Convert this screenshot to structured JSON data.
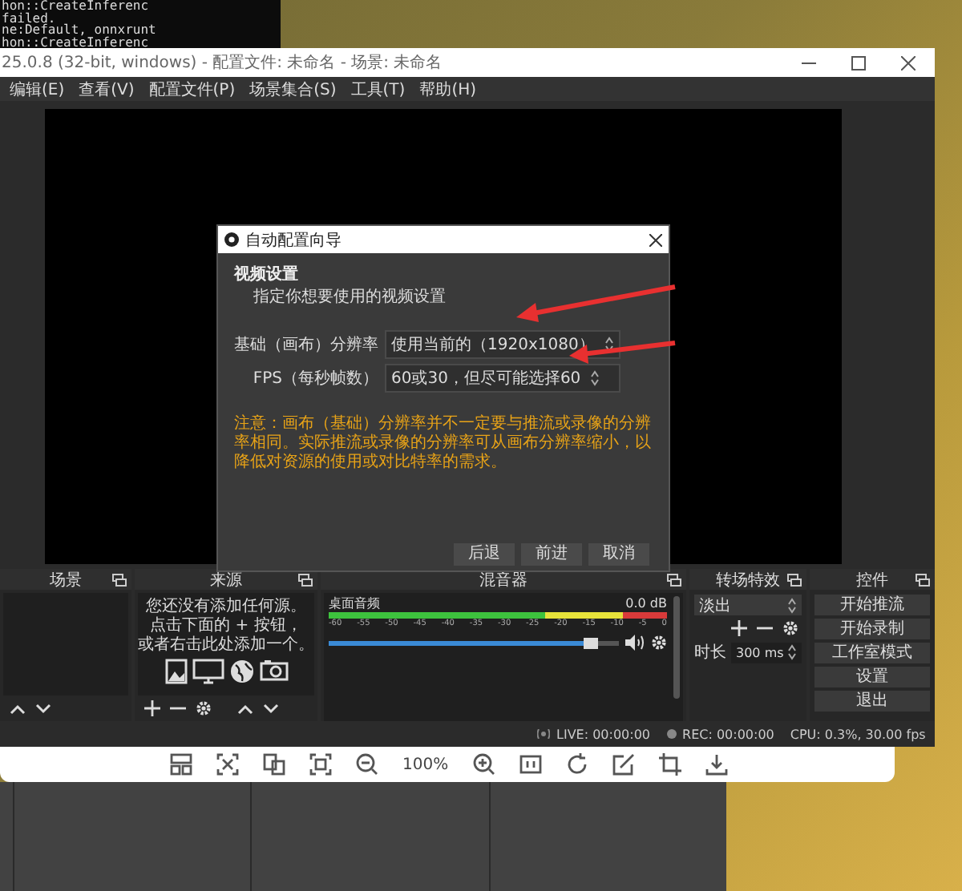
{
  "console": {
    "lines": [
      "hon::CreateInferenc",
      "failed.",
      "ne:Default, onnxrunt",
      "hon::CreateInferenc"
    ]
  },
  "window": {
    "title": "25.0.8 (32-bit, windows) - 配置文件: 未命名 - 场景: 未命名"
  },
  "menu": [
    "编辑(E)",
    "查看(V)",
    "配置文件(P)",
    "场景集合(S)",
    "工具(T)",
    "帮助(H)"
  ],
  "dialog": {
    "title": "自动配置向导",
    "heading": "视频设置",
    "subheading": "指定你想要使用的视频设置",
    "fields": [
      {
        "label": "基础（画布）分辨率",
        "value": "使用当前的（1920x1080）"
      },
      {
        "label": "FPS（每秒帧数）",
        "value": "60或30，但尽可能选择60"
      }
    ],
    "note": "注意：画布（基础）分辨率并不一定要与推流或录像的分辨率相同。实际推流或录像的分辨率可从画布分辨率缩小，以降低对资源的使用或对比特率的需求。",
    "buttons": [
      "后退",
      "前进",
      "取消"
    ]
  },
  "docks": {
    "scenes": {
      "title": "场景"
    },
    "sources": {
      "title": "来源",
      "empty_message": [
        "您还没有添加任何源。",
        "点击下面的 + 按钮，",
        "或者右击此处添加一个。"
      ]
    },
    "mixer": {
      "title": "混音器",
      "channels": [
        {
          "name": "桌面音频",
          "reading": "0.0 dB",
          "ticks": [
            "-60",
            "-55",
            "-50",
            "-45",
            "-40",
            "-35",
            "-30",
            "-25",
            "-20",
            "-15",
            "-10",
            "-5",
            "0"
          ],
          "level": 0.93
        }
      ]
    },
    "transitions": {
      "title": "转场特效",
      "selected": "淡出",
      "duration_label": "时长",
      "duration": "300 ms"
    },
    "controls": {
      "title": "控件",
      "buttons": [
        "开始推流",
        "开始录制",
        "工作室模式",
        "设置",
        "退出"
      ]
    }
  },
  "status_bar": {
    "live": "LIVE: 00:00:00",
    "rec": "REC: 00:00:00",
    "cpu": "CPU: 0.3%, 30.00 fps"
  },
  "viewer_toolbar": {
    "zoom": "100%"
  }
}
